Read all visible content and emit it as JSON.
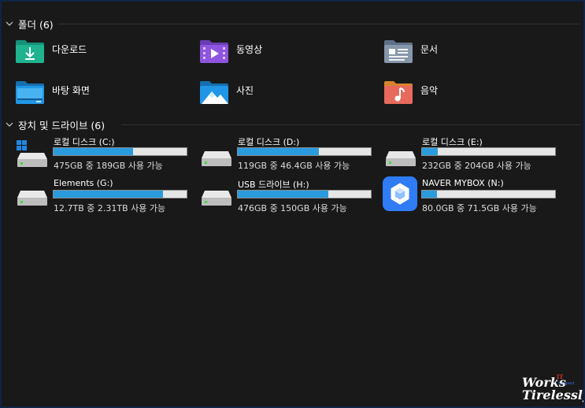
{
  "groups": {
    "folders": {
      "title": "폴더 (6)"
    },
    "drives": {
      "title": "장치 및 드라이브 (6)"
    }
  },
  "folders": [
    {
      "label": "다운로드",
      "icon": "download-folder-icon",
      "color": "#1aa88a"
    },
    {
      "label": "동영상",
      "icon": "videos-folder-icon",
      "color": "#8a4fd6"
    },
    {
      "label": "문서",
      "icon": "documents-folder-icon",
      "color": "#7d8ea3"
    },
    {
      "label": "바탕 화면",
      "icon": "desktop-folder-icon",
      "color": "#1c8fd8"
    },
    {
      "label": "사진",
      "icon": "pictures-folder-icon",
      "color": "#1c8fd8"
    },
    {
      "label": "음악",
      "icon": "music-folder-icon",
      "color": "#e06a5a"
    }
  ],
  "drives": [
    {
      "name": "로컬 디스크 (C:)",
      "info": "475GB 중 189GB 사용 가능",
      "used_fraction": 0.6,
      "icon": "system-drive-icon"
    },
    {
      "name": "로컬 디스크 (D:)",
      "info": "119GB 중 46.4GB 사용 가능",
      "used_fraction": 0.61,
      "icon": "hard-drive-icon"
    },
    {
      "name": "로컬 디스크 (E:)",
      "info": "232GB 중 204GB 사용 가능",
      "used_fraction": 0.12,
      "icon": "hard-drive-icon"
    },
    {
      "name": "Elements (G:)",
      "info": "12.7TB 중 2.31TB 사용 가능",
      "used_fraction": 0.82,
      "icon": "hard-drive-icon"
    },
    {
      "name": "USB 드라이브 (H:)",
      "info": "476GB 중 150GB 사용 가능",
      "used_fraction": 0.68,
      "icon": "hard-drive-icon"
    },
    {
      "name": "NAVER MYBOX (N:)",
      "info": "80.0GB 중 71.5GB 사용 가능",
      "used_fraction": 0.11,
      "icon": "naver-mybox-icon"
    }
  ],
  "watermark": {
    "line1": "Works",
    "it": "IT",
    "sub": "Support",
    "line2": "Tirelessly"
  },
  "colors": {
    "bar_fill": "#2a9cde",
    "bar_track": "#e6e6e6",
    "background": "#191919"
  }
}
